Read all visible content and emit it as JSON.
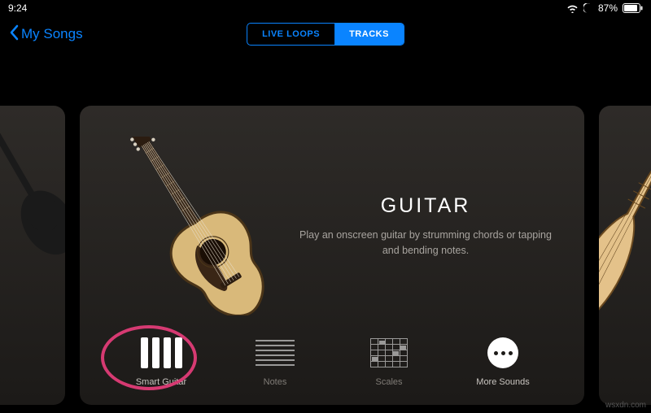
{
  "status": {
    "time": "9:24",
    "battery_pct": "87%"
  },
  "nav": {
    "back_label": "My Songs",
    "segments": {
      "live_loops": "LIVE LOOPS",
      "tracks": "TRACKS"
    }
  },
  "instrument": {
    "title": "GUITAR",
    "description": "Play an onscreen guitar by strumming chords or tapping and bending notes."
  },
  "options": {
    "smart_guitar": "Smart Guitar",
    "notes": "Notes",
    "scales": "Scales",
    "more_sounds": "More Sounds"
  },
  "watermark": "wsxdn.com"
}
